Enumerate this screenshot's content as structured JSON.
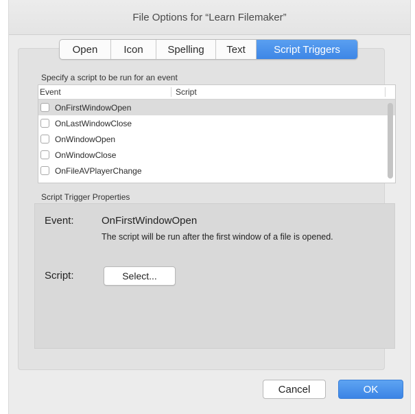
{
  "window": {
    "title": "File Options for “Learn Filemaker”"
  },
  "tabs": [
    {
      "label": "Open",
      "active": false
    },
    {
      "label": "Icon",
      "active": false
    },
    {
      "label": "Spelling",
      "active": false
    },
    {
      "label": "Text",
      "active": false
    },
    {
      "label": "Script Triggers",
      "active": true
    }
  ],
  "event_list": {
    "hint": "Specify a script to be run for an event",
    "columns": {
      "event": "Event",
      "script": "Script"
    },
    "rows": [
      {
        "event": "OnFirstWindowOpen",
        "script": "",
        "checked": false,
        "selected": true
      },
      {
        "event": "OnLastWindowClose",
        "script": "",
        "checked": false,
        "selected": false
      },
      {
        "event": "OnWindowOpen",
        "script": "",
        "checked": false,
        "selected": false
      },
      {
        "event": "OnWindowClose",
        "script": "",
        "checked": false,
        "selected": false
      },
      {
        "event": "OnFileAVPlayerChange",
        "script": "",
        "checked": false,
        "selected": false
      }
    ]
  },
  "properties": {
    "section_label": "Script Trigger Properties",
    "event_label": "Event:",
    "event_value": "OnFirstWindowOpen",
    "description": "The script will be run after the first window of a file is opened.",
    "script_label": "Script:",
    "select_button": "Select..."
  },
  "footer": {
    "cancel": "Cancel",
    "ok": "OK"
  },
  "colors": {
    "accent": "#3d86e6",
    "selected_row": "#dcdcdc"
  }
}
